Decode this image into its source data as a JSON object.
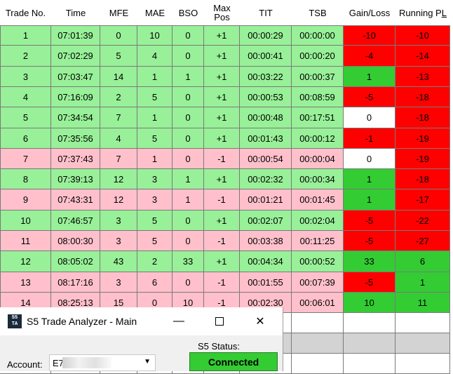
{
  "columns": [
    "Trade No.",
    "Time",
    "MFE",
    "MAE",
    "BSO",
    "Max Pos",
    "TIT",
    "TSB",
    "Gain/Loss",
    "Running PL"
  ],
  "rows": [
    {
      "no": "1",
      "time": "07:01:39",
      "mfe": "0",
      "mae": "10",
      "bso": "0",
      "maxpos": "+1",
      "tit": "00:00:29",
      "tsb": "00:00:00",
      "gl": "-10",
      "pl": "-10",
      "row": "green",
      "gl_color": "red",
      "pl_color": "red"
    },
    {
      "no": "2",
      "time": "07:02:29",
      "mfe": "5",
      "mae": "4",
      "bso": "0",
      "maxpos": "+1",
      "tit": "00:00:41",
      "tsb": "00:00:20",
      "gl": "-4",
      "pl": "-14",
      "row": "green",
      "gl_color": "red",
      "pl_color": "red"
    },
    {
      "no": "3",
      "time": "07:03:47",
      "mfe": "14",
      "mae": "1",
      "bso": "1",
      "maxpos": "+1",
      "tit": "00:03:22",
      "tsb": "00:00:37",
      "gl": "1",
      "pl": "-13",
      "row": "green",
      "gl_color": "green",
      "pl_color": "red"
    },
    {
      "no": "4",
      "time": "07:16:09",
      "mfe": "2",
      "mae": "5",
      "bso": "0",
      "maxpos": "+1",
      "tit": "00:00:53",
      "tsb": "00:08:59",
      "gl": "-5",
      "pl": "-18",
      "row": "green",
      "gl_color": "red",
      "pl_color": "red"
    },
    {
      "no": "5",
      "time": "07:34:54",
      "mfe": "7",
      "mae": "1",
      "bso": "0",
      "maxpos": "+1",
      "tit": "00:00:48",
      "tsb": "00:17:51",
      "gl": "0",
      "pl": "-18",
      "row": "green",
      "gl_color": "white",
      "pl_color": "red"
    },
    {
      "no": "6",
      "time": "07:35:56",
      "mfe": "4",
      "mae": "5",
      "bso": "0",
      "maxpos": "+1",
      "tit": "00:01:43",
      "tsb": "00:00:12",
      "gl": "-1",
      "pl": "-19",
      "row": "green",
      "gl_color": "red",
      "pl_color": "red"
    },
    {
      "no": "7",
      "time": "07:37:43",
      "mfe": "7",
      "mae": "1",
      "bso": "0",
      "maxpos": "-1",
      "tit": "00:00:54",
      "tsb": "00:00:04",
      "gl": "0",
      "pl": "-19",
      "row": "pink",
      "gl_color": "white",
      "pl_color": "red"
    },
    {
      "no": "8",
      "time": "07:39:13",
      "mfe": "12",
      "mae": "3",
      "bso": "1",
      "maxpos": "+1",
      "tit": "00:02:32",
      "tsb": "00:00:34",
      "gl": "1",
      "pl": "-18",
      "row": "green",
      "gl_color": "green",
      "pl_color": "red"
    },
    {
      "no": "9",
      "time": "07:43:31",
      "mfe": "12",
      "mae": "3",
      "bso": "1",
      "maxpos": "-1",
      "tit": "00:01:21",
      "tsb": "00:01:45",
      "gl": "1",
      "pl": "-17",
      "row": "pink",
      "gl_color": "green",
      "pl_color": "red"
    },
    {
      "no": "10",
      "time": "07:46:57",
      "mfe": "3",
      "mae": "5",
      "bso": "0",
      "maxpos": "+1",
      "tit": "00:02:07",
      "tsb": "00:02:04",
      "gl": "-5",
      "pl": "-22",
      "row": "green",
      "gl_color": "red",
      "pl_color": "red"
    },
    {
      "no": "11",
      "time": "08:00:30",
      "mfe": "3",
      "mae": "5",
      "bso": "0",
      "maxpos": "-1",
      "tit": "00:03:38",
      "tsb": "00:11:25",
      "gl": "-5",
      "pl": "-27",
      "row": "pink",
      "gl_color": "red",
      "pl_color": "red"
    },
    {
      "no": "12",
      "time": "08:05:02",
      "mfe": "43",
      "mae": "2",
      "bso": "33",
      "maxpos": "+1",
      "tit": "00:04:34",
      "tsb": "00:00:52",
      "gl": "33",
      "pl": "6",
      "row": "green",
      "gl_color": "green",
      "pl_color": "green"
    },
    {
      "no": "13",
      "time": "08:17:16",
      "mfe": "3",
      "mae": "6",
      "bso": "0",
      "maxpos": "-1",
      "tit": "00:01:55",
      "tsb": "00:07:39",
      "gl": "-5",
      "pl": "1",
      "row": "pink",
      "gl_color": "red",
      "pl_color": "green"
    },
    {
      "no": "14",
      "time": "08:25:13",
      "mfe": "15",
      "mae": "0",
      "bso": "10",
      "maxpos": "-1",
      "tit": "00:02:30",
      "tsb": "00:06:01",
      "gl": "10",
      "pl": "11",
      "row": "pink",
      "gl_color": "green",
      "pl_color": "green"
    }
  ],
  "colors": {
    "row_green": "#98f098",
    "row_pink": "#ffc0cb",
    "red": "#ff0000",
    "green": "#33cc33",
    "white": "#ffffff",
    "grey": "#d3d3d3"
  },
  "window": {
    "title": "S5 Trade Analyzer - Main",
    "app_icon": "S5 TA",
    "minimize_icon": "minimize-icon",
    "maximize_icon": "maximize-icon",
    "close_icon": "close-icon",
    "status_label": "S5 Status:",
    "status_value": "Connected",
    "account_label": "Account:",
    "account_value": "E7"
  }
}
